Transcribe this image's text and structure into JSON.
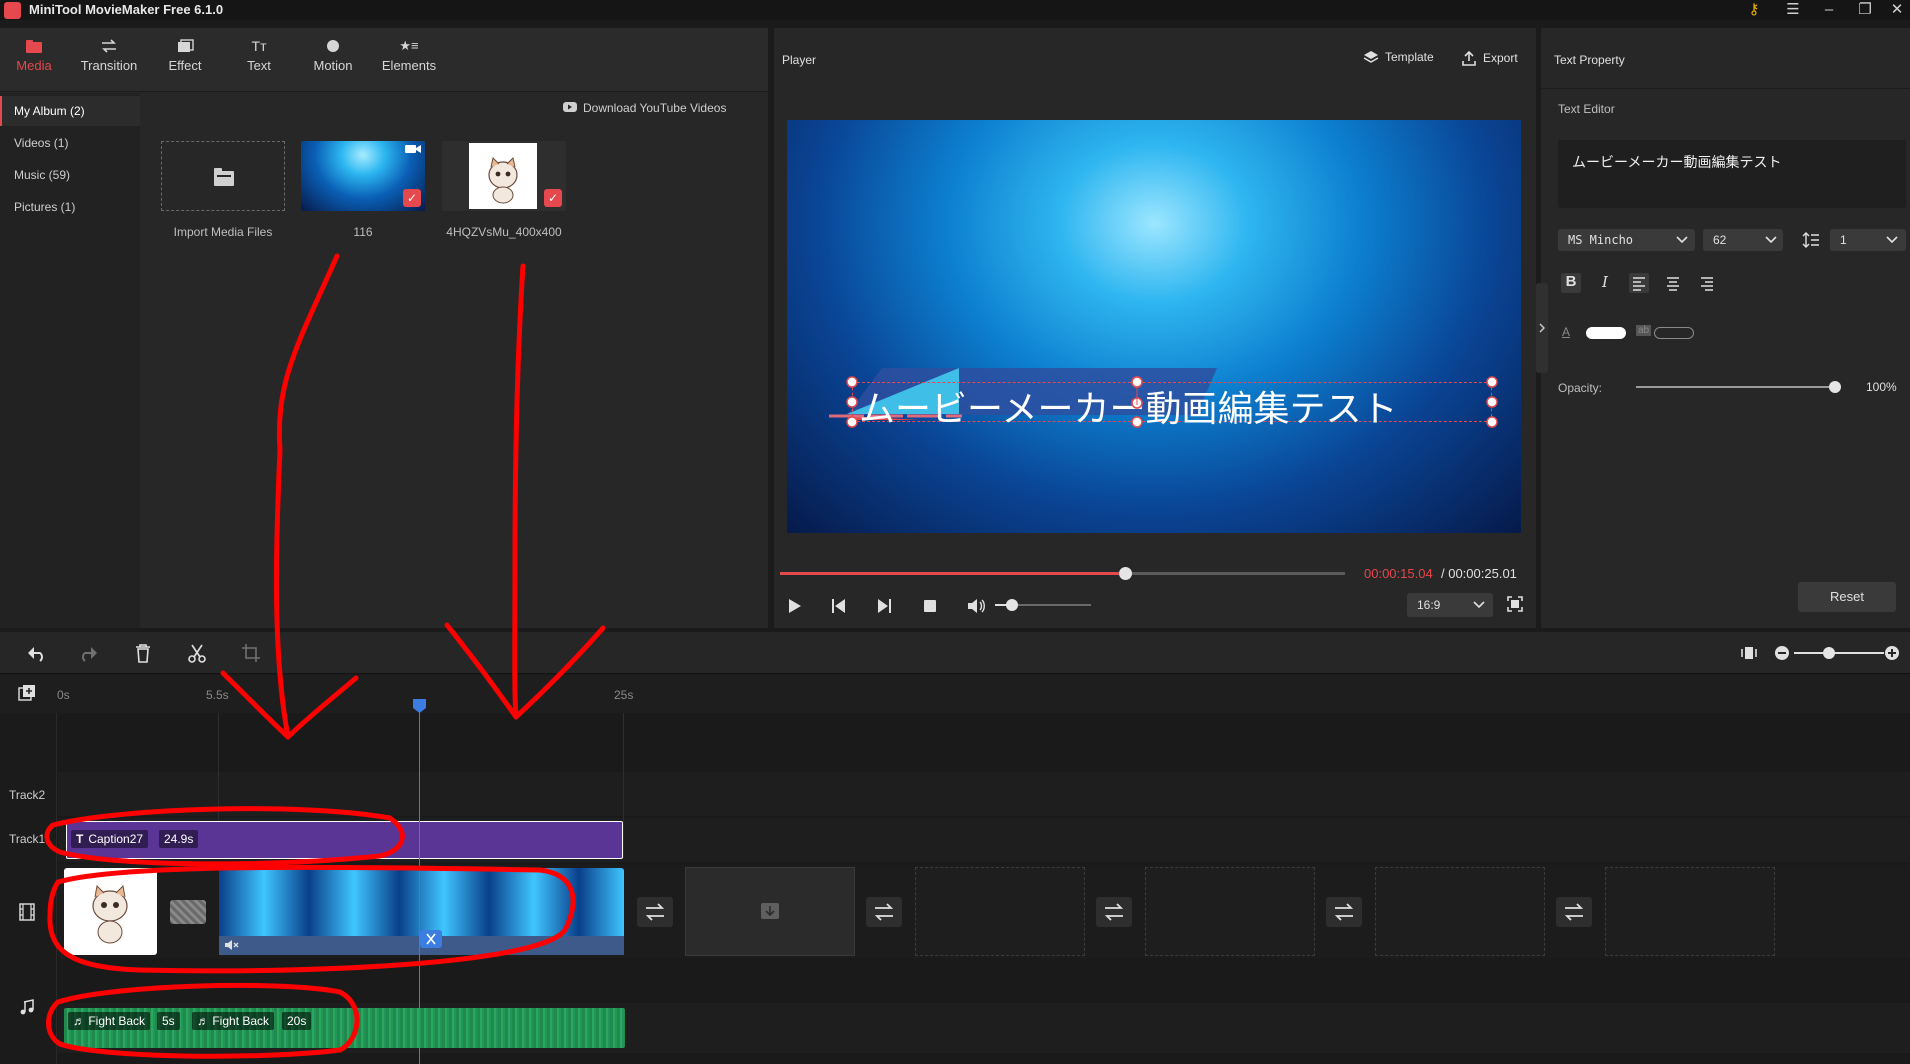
{
  "app": {
    "title": "MiniTool MovieMaker Free 6.1.0"
  },
  "tabs": [
    {
      "label": "Media",
      "icon": "folder-icon",
      "active": true
    },
    {
      "label": "Transition",
      "icon": "swap-icon"
    },
    {
      "label": "Effect",
      "icon": "effect-icon"
    },
    {
      "label": "Text",
      "icon": "text-icon"
    },
    {
      "label": "Motion",
      "icon": "motion-icon"
    },
    {
      "label": "Elements",
      "icon": "elements-icon"
    }
  ],
  "sidebar": {
    "items": [
      {
        "label": "My Album (2)",
        "active": true
      },
      {
        "label": "Videos (1)"
      },
      {
        "label": "Music (59)"
      },
      {
        "label": "Pictures (1)"
      }
    ]
  },
  "library": {
    "download_label": "Download YouTube Videos",
    "import_label": "Import Media Files",
    "media": [
      {
        "label": "116",
        "type": "video"
      },
      {
        "label": "4HQZVsMu_400x400",
        "type": "image"
      }
    ]
  },
  "player": {
    "title": "Player",
    "template_label": "Template",
    "export_label": "Export",
    "overlay_text": "ムービーメーカー動画編集テスト",
    "time_current": "00:00:15.04",
    "time_total": " / 00:00:25.01",
    "progress": 0.61,
    "volume": 0.1,
    "ratio": "16:9"
  },
  "text_property": {
    "title": "Text Property",
    "editor_label": "Text Editor",
    "editor_text": "ムービーメーカー動画編集テスト",
    "font": "MS Mincho",
    "size": "62",
    "line_spacing": "1",
    "opacity_label": "Opacity:",
    "opacity_value": "100%",
    "reset_label": "Reset"
  },
  "timeline": {
    "ticks": [
      "0s",
      "5.5s",
      "25s"
    ],
    "tracks": {
      "track2": "Track2",
      "track1": "Track1"
    },
    "caption_clip": {
      "name": "Caption27",
      "duration": "24.9s"
    },
    "audio_clips": [
      {
        "name": "Fight Back",
        "duration": "5s"
      },
      {
        "name": "Fight Back",
        "duration": "20s"
      }
    ],
    "zoom": 0.55
  },
  "colors": {
    "accent": "#e5484d",
    "caption_clip": "#5a3595",
    "audio_clip": "#22955a",
    "annotation": "#ff0000"
  }
}
